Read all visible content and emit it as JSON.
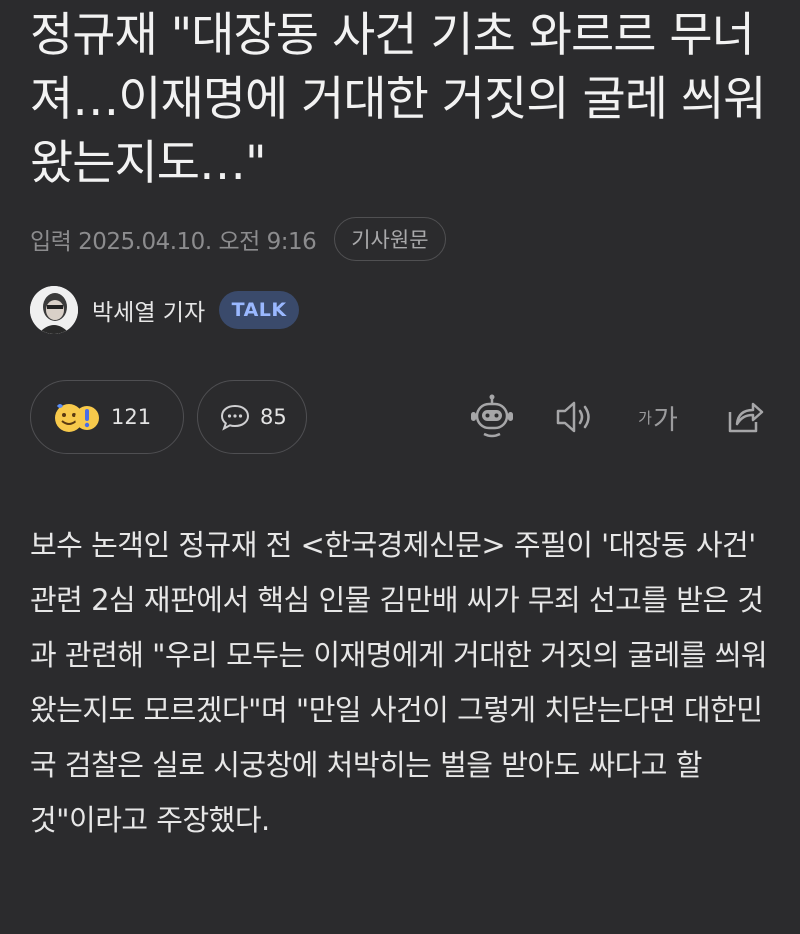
{
  "article": {
    "headline": "정규재 \"대장동 사건 기초 와르르 무너져…이재명에 거대한 거짓의 굴레 씌워왔는지도…\"",
    "date": "입력 2025.04.10. 오전 9:16",
    "original_label": "기사원문",
    "reporter": {
      "name": "박세열 기자",
      "badge": "TALK"
    },
    "reactions": {
      "count": "121"
    },
    "comments": {
      "count": "85"
    },
    "toolbar": {
      "fontsize_small": "가",
      "fontsize_big": "가"
    },
    "body": "보수 논객인 정규재 전 <한국경제신문> 주필이 '대장동 사건' 관련 2심 재판에서 핵심 인물 김만배 씨가 무죄 선고를 받은 것과 관련해 \"우리 모두는 이재명에게 거대한 거짓의 굴레를 씌워왔는지도 모르겠다\"며 \"만일 사건이 그렇게 치닫는다면 대한민국 검찰은 실로 시궁창에 처박히는 벌을 받아도 싸다고 할 것\"이라고 주장했다."
  },
  "icons": {
    "reaction": "smile-emoji-icon",
    "comment": "speech-bubble-icon",
    "summary": "robot-icon",
    "speaker": "speaker-icon",
    "share": "share-icon"
  },
  "colors": {
    "background": "#2b2b2d",
    "talk_badge_bg": "#3a4a6b",
    "talk_badge_text": "#9ab8ff"
  }
}
